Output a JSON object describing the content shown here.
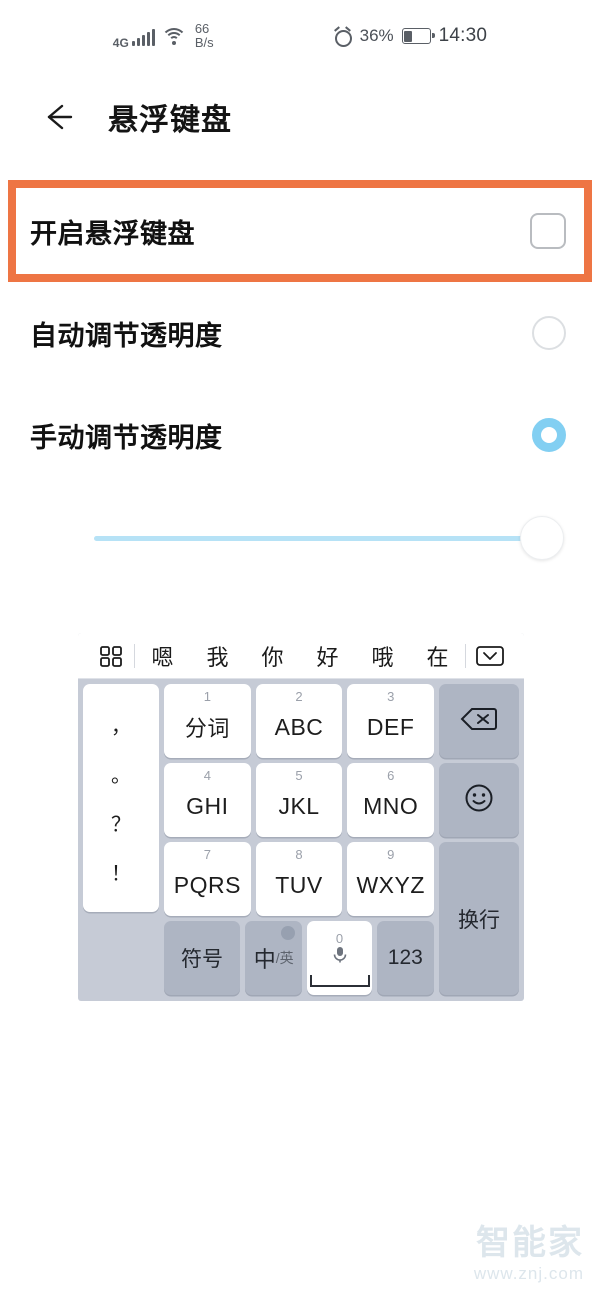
{
  "status_bar": {
    "network_type": "4G",
    "net_speed_value": "66",
    "net_speed_unit": "B/s",
    "battery_percent": "36%",
    "time": "14:30",
    "icons": {
      "signal": "signal-bars-icon",
      "wifi": "wifi-icon",
      "alarm": "alarm-clock-icon",
      "battery": "battery-icon"
    }
  },
  "header": {
    "back_icon": "back-arrow-icon",
    "title": "悬浮键盘"
  },
  "settings": {
    "rows": [
      {
        "label": "开启悬浮键盘",
        "control": "checkbox",
        "checked": false,
        "highlighted": true
      },
      {
        "label": "自动调节透明度",
        "control": "radio",
        "checked": false,
        "highlighted": false
      },
      {
        "label": "手动调节透明度",
        "control": "radio",
        "checked": true,
        "highlighted": false
      }
    ],
    "slider": {
      "value": 100,
      "min": 0,
      "max": 100
    }
  },
  "colors": {
    "highlight_border": "#ee7544",
    "radio_selected": "#82cff2",
    "slider_track": "#b6e2f6",
    "key_gray": "#aeb5c3",
    "keyboard_bg": "#c6cbd6"
  },
  "keyboard": {
    "candidate_bar": {
      "left_icon": "grid-squares-icon",
      "words": [
        "嗯",
        "我",
        "你",
        "好",
        "哦",
        "在"
      ],
      "right_icon": "collapse-keyboard-icon"
    },
    "punctuation_key": [
      "，",
      "。",
      "？",
      "！"
    ],
    "rows": [
      [
        {
          "sup": "1",
          "main": "分词",
          "cn": true
        },
        {
          "sup": "2",
          "main": "ABC",
          "cn": false
        },
        {
          "sup": "3",
          "main": "DEF",
          "cn": false
        }
      ],
      [
        {
          "sup": "4",
          "main": "GHI",
          "cn": false
        },
        {
          "sup": "5",
          "main": "JKL",
          "cn": false
        },
        {
          "sup": "6",
          "main": "MNO",
          "cn": false
        }
      ],
      [
        {
          "sup": "7",
          "main": "PQRS",
          "cn": false
        },
        {
          "sup": "8",
          "main": "TUV",
          "cn": false
        },
        {
          "sup": "9",
          "main": "WXYZ",
          "cn": false
        }
      ]
    ],
    "right_column": {
      "backspace_icon": "backspace-icon",
      "emoji_icon": "emoji-smiley-icon",
      "enter_label": "换行"
    },
    "bottom_row": {
      "symbol_label": "符号",
      "lang_main": "中",
      "lang_sub": "/英",
      "lang_badge_icon": "globe-icon",
      "space_sup": "0",
      "space_icon": "microphone-icon",
      "number_label": "123"
    }
  },
  "watermark": {
    "brand": "智能家",
    "url": "www.znj.com"
  }
}
